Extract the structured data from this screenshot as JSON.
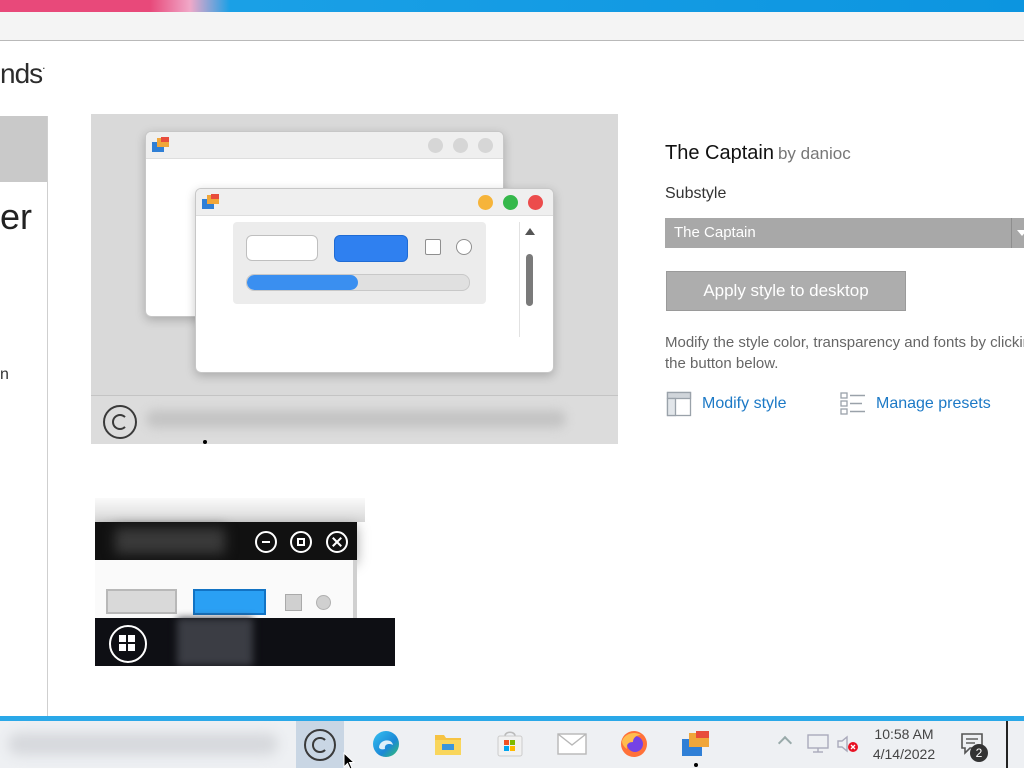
{
  "brand": {
    "text": "nds",
    "mark": "."
  },
  "left_pane": {
    "heading_fragment": "er",
    "text_fragment": "n"
  },
  "style": {
    "name": "The Captain",
    "author": "by danioc",
    "substyle_label": "Substyle",
    "substyle_value": "The Captain",
    "apply_label": "Apply style to desktop",
    "description": "Modify the style color, transparency and fonts by clicking the button below.",
    "modify_label": "Modify style",
    "presets_label": "Manage presets"
  },
  "preview": {
    "progress_fraction": 0.5,
    "traffic_light_colors": [
      "#f6b43a",
      "#35b84b",
      "#ec4c4c"
    ],
    "start_icon": "copyright-icon"
  },
  "taskbar": {
    "icons": [
      "stardock-start-icon",
      "edge-icon",
      "file-explorer-icon",
      "store-icon",
      "mail-icon",
      "firefox-icon",
      "windowblinds-icon"
    ],
    "time": "10:58 AM",
    "date": "4/14/2022",
    "notification_count": "2"
  },
  "colors": {
    "accent": "#2aa8e8",
    "link": "#1c79c6",
    "button": "#adadad"
  }
}
